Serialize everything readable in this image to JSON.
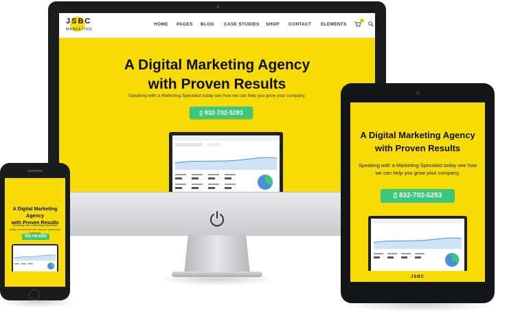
{
  "nav": {
    "logo_main": "JSBC",
    "logo_sub": "MARKETING",
    "items": [
      "HOME",
      "PAGES",
      "BLOG",
      "CASE STUDIES",
      "SHOP",
      "CONTACT",
      "ELEMENTS"
    ],
    "cart_count": "0"
  },
  "hero": {
    "title_line1": "A Digital Marketing Agency",
    "title_line2": "with Proven Results",
    "subtitle": "Speaking with a Marketing Specialist today see how we can help you grow your company.",
    "phone_button": "832-702-5293"
  },
  "tablet": {
    "title_line1": "A Digital Marketing Agency",
    "title_line2": "with Proven Results",
    "subtitle": "Speaking with a Marketing Specialist today see how we can help you grow your company.",
    "phone_button": "832-702-5293",
    "logo": "JSBC"
  },
  "phone": {
    "title_line1": "A Digital Marketing Agency",
    "title_line2": "with Proven Results",
    "subtitle": "Speaking with a Marketing Specialist today see how we can help you grow your company.",
    "phone_button": "832-702-5293"
  },
  "colors": {
    "brand_yellow": "#f7dc06",
    "button_green": "#3cc77a",
    "device_dark": "#1b1c1e"
  }
}
